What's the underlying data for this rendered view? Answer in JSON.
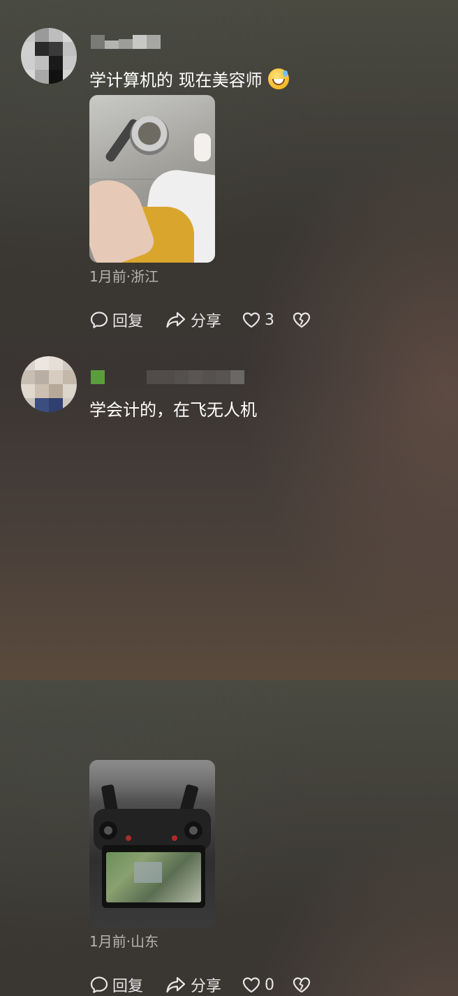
{
  "comments": [
    {
      "text": "学计算机的 现在美容师",
      "emoji": "grinning-sweat-emoji",
      "meta": "1月前·浙江",
      "reply_label": "回复",
      "share_label": "分享",
      "like_count": "3",
      "photo": "photo showing a hand holding a metal cup on a floor"
    },
    {
      "text": "学会计的，在飞无人机",
      "emoji": null,
      "meta": "1月前·山东",
      "reply_label": "回复",
      "share_label": "分享",
      "like_count": "0",
      "photo": "photo of a drone remote controller with screen"
    }
  ],
  "icons": {
    "reply": "speech-bubble-icon",
    "share": "share-arrow-icon",
    "like": "heart-icon",
    "dislike": "broken-heart-icon"
  },
  "colors": {
    "text": "#ffffff",
    "meta": "#a9a5a0",
    "green_badge": "#5a9e3c"
  }
}
